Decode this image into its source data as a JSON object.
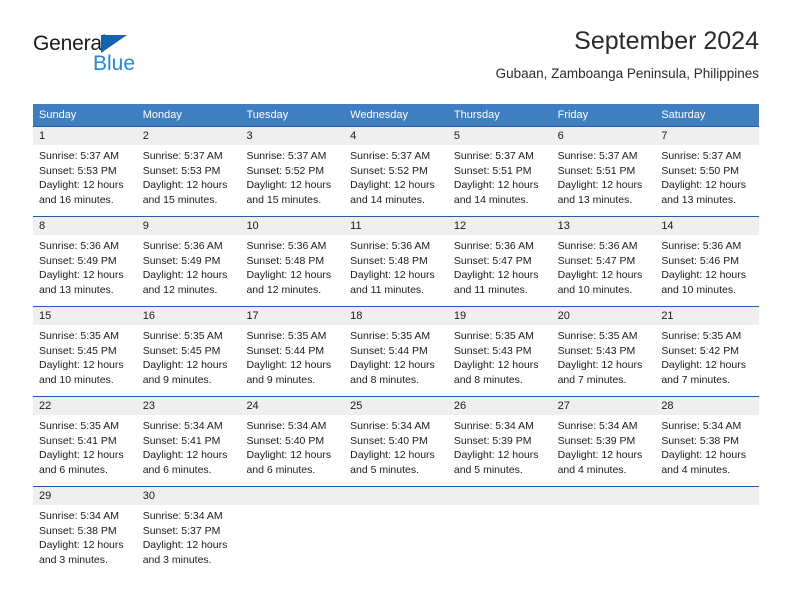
{
  "brand": {
    "name_dark": "General",
    "name_blue": "Blue",
    "accent_dark_blue": "#1562ad",
    "accent_light_blue": "#2489d6"
  },
  "header": {
    "title": "September 2024",
    "subtitle": "Gubaan, Zamboanga Peninsula, Philippines"
  },
  "calendar": {
    "header_bg": "#3f7fc1",
    "cell_border": "#1f5fa8",
    "daynum_bg": "#efefef",
    "weekdays": [
      "Sunday",
      "Monday",
      "Tuesday",
      "Wednesday",
      "Thursday",
      "Friday",
      "Saturday"
    ],
    "weeks": [
      [
        {
          "day": "1",
          "sunrise": "Sunrise: 5:37 AM",
          "sunset": "Sunset: 5:53 PM",
          "daylight1": "Daylight: 12 hours",
          "daylight2": "and 16 minutes."
        },
        {
          "day": "2",
          "sunrise": "Sunrise: 5:37 AM",
          "sunset": "Sunset: 5:53 PM",
          "daylight1": "Daylight: 12 hours",
          "daylight2": "and 15 minutes."
        },
        {
          "day": "3",
          "sunrise": "Sunrise: 5:37 AM",
          "sunset": "Sunset: 5:52 PM",
          "daylight1": "Daylight: 12 hours",
          "daylight2": "and 15 minutes."
        },
        {
          "day": "4",
          "sunrise": "Sunrise: 5:37 AM",
          "sunset": "Sunset: 5:52 PM",
          "daylight1": "Daylight: 12 hours",
          "daylight2": "and 14 minutes."
        },
        {
          "day": "5",
          "sunrise": "Sunrise: 5:37 AM",
          "sunset": "Sunset: 5:51 PM",
          "daylight1": "Daylight: 12 hours",
          "daylight2": "and 14 minutes."
        },
        {
          "day": "6",
          "sunrise": "Sunrise: 5:37 AM",
          "sunset": "Sunset: 5:51 PM",
          "daylight1": "Daylight: 12 hours",
          "daylight2": "and 13 minutes."
        },
        {
          "day": "7",
          "sunrise": "Sunrise: 5:37 AM",
          "sunset": "Sunset: 5:50 PM",
          "daylight1": "Daylight: 12 hours",
          "daylight2": "and 13 minutes."
        }
      ],
      [
        {
          "day": "8",
          "sunrise": "Sunrise: 5:36 AM",
          "sunset": "Sunset: 5:49 PM",
          "daylight1": "Daylight: 12 hours",
          "daylight2": "and 13 minutes."
        },
        {
          "day": "9",
          "sunrise": "Sunrise: 5:36 AM",
          "sunset": "Sunset: 5:49 PM",
          "daylight1": "Daylight: 12 hours",
          "daylight2": "and 12 minutes."
        },
        {
          "day": "10",
          "sunrise": "Sunrise: 5:36 AM",
          "sunset": "Sunset: 5:48 PM",
          "daylight1": "Daylight: 12 hours",
          "daylight2": "and 12 minutes."
        },
        {
          "day": "11",
          "sunrise": "Sunrise: 5:36 AM",
          "sunset": "Sunset: 5:48 PM",
          "daylight1": "Daylight: 12 hours",
          "daylight2": "and 11 minutes."
        },
        {
          "day": "12",
          "sunrise": "Sunrise: 5:36 AM",
          "sunset": "Sunset: 5:47 PM",
          "daylight1": "Daylight: 12 hours",
          "daylight2": "and 11 minutes."
        },
        {
          "day": "13",
          "sunrise": "Sunrise: 5:36 AM",
          "sunset": "Sunset: 5:47 PM",
          "daylight1": "Daylight: 12 hours",
          "daylight2": "and 10 minutes."
        },
        {
          "day": "14",
          "sunrise": "Sunrise: 5:36 AM",
          "sunset": "Sunset: 5:46 PM",
          "daylight1": "Daylight: 12 hours",
          "daylight2": "and 10 minutes."
        }
      ],
      [
        {
          "day": "15",
          "sunrise": "Sunrise: 5:35 AM",
          "sunset": "Sunset: 5:45 PM",
          "daylight1": "Daylight: 12 hours",
          "daylight2": "and 10 minutes."
        },
        {
          "day": "16",
          "sunrise": "Sunrise: 5:35 AM",
          "sunset": "Sunset: 5:45 PM",
          "daylight1": "Daylight: 12 hours",
          "daylight2": "and 9 minutes."
        },
        {
          "day": "17",
          "sunrise": "Sunrise: 5:35 AM",
          "sunset": "Sunset: 5:44 PM",
          "daylight1": "Daylight: 12 hours",
          "daylight2": "and 9 minutes."
        },
        {
          "day": "18",
          "sunrise": "Sunrise: 5:35 AM",
          "sunset": "Sunset: 5:44 PM",
          "daylight1": "Daylight: 12 hours",
          "daylight2": "and 8 minutes."
        },
        {
          "day": "19",
          "sunrise": "Sunrise: 5:35 AM",
          "sunset": "Sunset: 5:43 PM",
          "daylight1": "Daylight: 12 hours",
          "daylight2": "and 8 minutes."
        },
        {
          "day": "20",
          "sunrise": "Sunrise: 5:35 AM",
          "sunset": "Sunset: 5:43 PM",
          "daylight1": "Daylight: 12 hours",
          "daylight2": "and 7 minutes."
        },
        {
          "day": "21",
          "sunrise": "Sunrise: 5:35 AM",
          "sunset": "Sunset: 5:42 PM",
          "daylight1": "Daylight: 12 hours",
          "daylight2": "and 7 minutes."
        }
      ],
      [
        {
          "day": "22",
          "sunrise": "Sunrise: 5:35 AM",
          "sunset": "Sunset: 5:41 PM",
          "daylight1": "Daylight: 12 hours",
          "daylight2": "and 6 minutes."
        },
        {
          "day": "23",
          "sunrise": "Sunrise: 5:34 AM",
          "sunset": "Sunset: 5:41 PM",
          "daylight1": "Daylight: 12 hours",
          "daylight2": "and 6 minutes."
        },
        {
          "day": "24",
          "sunrise": "Sunrise: 5:34 AM",
          "sunset": "Sunset: 5:40 PM",
          "daylight1": "Daylight: 12 hours",
          "daylight2": "and 6 minutes."
        },
        {
          "day": "25",
          "sunrise": "Sunrise: 5:34 AM",
          "sunset": "Sunset: 5:40 PM",
          "daylight1": "Daylight: 12 hours",
          "daylight2": "and 5 minutes."
        },
        {
          "day": "26",
          "sunrise": "Sunrise: 5:34 AM",
          "sunset": "Sunset: 5:39 PM",
          "daylight1": "Daylight: 12 hours",
          "daylight2": "and 5 minutes."
        },
        {
          "day": "27",
          "sunrise": "Sunrise: 5:34 AM",
          "sunset": "Sunset: 5:39 PM",
          "daylight1": "Daylight: 12 hours",
          "daylight2": "and 4 minutes."
        },
        {
          "day": "28",
          "sunrise": "Sunrise: 5:34 AM",
          "sunset": "Sunset: 5:38 PM",
          "daylight1": "Daylight: 12 hours",
          "daylight2": "and 4 minutes."
        }
      ],
      [
        {
          "day": "29",
          "sunrise": "Sunrise: 5:34 AM",
          "sunset": "Sunset: 5:38 PM",
          "daylight1": "Daylight: 12 hours",
          "daylight2": "and 3 minutes."
        },
        {
          "day": "30",
          "sunrise": "Sunrise: 5:34 AM",
          "sunset": "Sunset: 5:37 PM",
          "daylight1": "Daylight: 12 hours",
          "daylight2": "and 3 minutes."
        },
        {
          "day": "",
          "sunrise": "",
          "sunset": "",
          "daylight1": "",
          "daylight2": ""
        },
        {
          "day": "",
          "sunrise": "",
          "sunset": "",
          "daylight1": "",
          "daylight2": ""
        },
        {
          "day": "",
          "sunrise": "",
          "sunset": "",
          "daylight1": "",
          "daylight2": ""
        },
        {
          "day": "",
          "sunrise": "",
          "sunset": "",
          "daylight1": "",
          "daylight2": ""
        },
        {
          "day": "",
          "sunrise": "",
          "sunset": "",
          "daylight1": "",
          "daylight2": ""
        }
      ]
    ]
  }
}
